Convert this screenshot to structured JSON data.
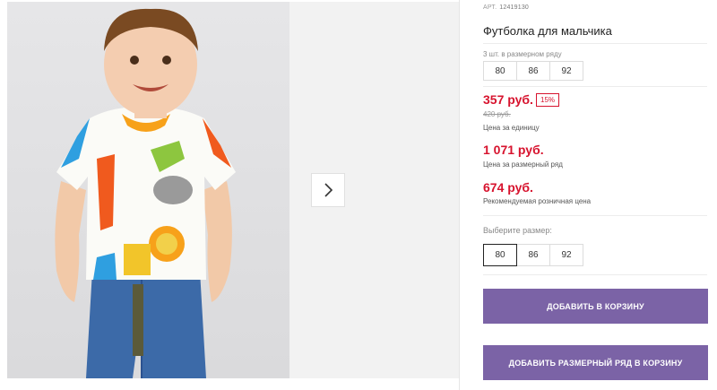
{
  "product": {
    "article_label": "АРТ.",
    "article_number": "12419130",
    "title": "Футболка для мальчика"
  },
  "size_set": {
    "note": "3 шт. в размерном ряду",
    "sizes": [
      "80",
      "86",
      "92"
    ]
  },
  "pricing": {
    "unit_price": "357 руб.",
    "discount": "15%",
    "old_price": "420 руб.",
    "unit_caption": "Цена за единицу",
    "set_price": "1 071 руб.",
    "set_caption": "Цена за размерный ряд",
    "retail_price": "674 руб.",
    "retail_caption": "Рекомендуемая розничная цена"
  },
  "size_picker": {
    "label": "Выберите размер:",
    "options": [
      "80",
      "86",
      "92"
    ],
    "selected": "80"
  },
  "actions": {
    "add_to_cart": "ДОБАВИТЬ В КОРЗИНУ",
    "add_set_to_cart": "ДОБАВИТЬ РАЗМЕРНЫЙ РЯД В КОРЗИНУ"
  },
  "colors": {
    "accent_red": "#d7132e",
    "button_purple": "#7b63a6"
  },
  "icons": {
    "next": "chevron-right-icon"
  }
}
